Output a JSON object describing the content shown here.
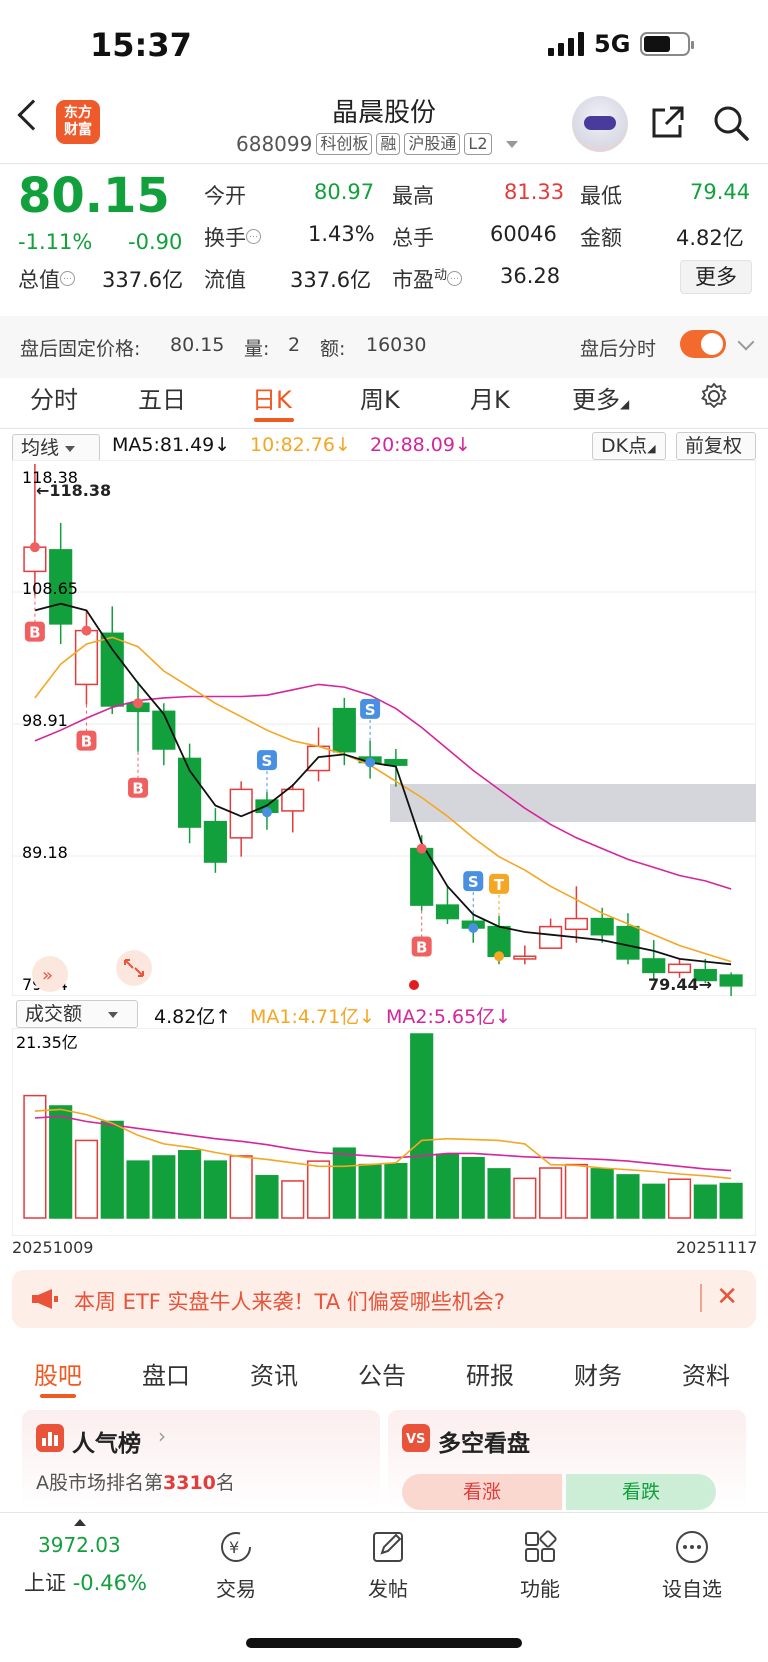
{
  "status": {
    "time": "15:37",
    "network": "5G"
  },
  "header": {
    "logo_text": "东方财富",
    "stock_name": "晶晨股份",
    "stock_code": "688099",
    "tags": [
      "科创板",
      "融",
      "沪股通",
      "L2"
    ]
  },
  "quote": {
    "price": "80.15",
    "change_pct": "-1.11%",
    "change": "-0.90",
    "open_label": "今开",
    "open": "80.97",
    "high_label": "最高",
    "high": "81.33",
    "low_label": "最低",
    "low": "79.44",
    "turnover_label": "换手",
    "turnover": "1.43%",
    "volume_label": "总手",
    "volume": "60046",
    "amount_label": "金额",
    "amount": "4.82亿",
    "mktcap_label": "总值",
    "mktcap": "337.6亿",
    "float_label": "流值",
    "float_cap": "337.6亿",
    "pe_label": "市盈",
    "pe_sup": "动",
    "pe": "36.28",
    "more": "更多"
  },
  "after_hours": {
    "label": "盘后固定价格:",
    "price": "80.15",
    "vol_label": "量:",
    "vol": "2",
    "amt_label": "额:",
    "amt": "16030",
    "switch_label": "盘后分时"
  },
  "tabs": [
    "分时",
    "五日",
    "日K",
    "周K",
    "月K",
    "更多"
  ],
  "active_tab": "日K",
  "ma_bar": {
    "selector": "均线",
    "ma5": "MA5:81.49↓",
    "ma10": "10:82.76↓",
    "ma20": "20:88.09↓",
    "dk": "DK点",
    "adjust": "前复权"
  },
  "colors": {
    "up": "#e43b3b",
    "down": "#11a03c",
    "ma5": "#111111",
    "ma10": "#f5a623",
    "ma20": "#d6259b",
    "accent": "#f05a22"
  },
  "chart_data": {
    "type": "candlestick",
    "price_axis_labels": [
      "118.38",
      "108.65",
      "98.91",
      "89.18",
      "79.44"
    ],
    "ylim": [
      79.44,
      118.38
    ],
    "annotations": {
      "max": "←118.38",
      "min": "79.44→"
    },
    "candles": [
      {
        "o": 110.4,
        "c": 112.2,
        "h": 118.38,
        "l": 108.6
      },
      {
        "o": 112.0,
        "c": 106.5,
        "h": 114.0,
        "l": 105.0
      },
      {
        "o": 102.0,
        "c": 106.0,
        "h": 107.5,
        "l": 100.5
      },
      {
        "o": 105.8,
        "c": 100.4,
        "h": 107.8,
        "l": 99.8
      },
      {
        "o": 100.6,
        "c": 100.0,
        "h": 102.2,
        "l": 97.0
      },
      {
        "o": 100.0,
        "c": 97.2,
        "h": 100.6,
        "l": 96.0
      },
      {
        "o": 96.5,
        "c": 91.4,
        "h": 97.6,
        "l": 90.2
      },
      {
        "o": 91.8,
        "c": 88.8,
        "h": 92.8,
        "l": 88.0
      },
      {
        "o": 90.6,
        "c": 94.2,
        "h": 94.8,
        "l": 89.2
      },
      {
        "o": 93.4,
        "c": 92.5,
        "h": 94.0,
        "l": 91.2
      },
      {
        "o": 92.6,
        "c": 94.2,
        "h": 94.6,
        "l": 91.0
      },
      {
        "o": 95.6,
        "c": 97.4,
        "h": 98.8,
        "l": 94.8
      },
      {
        "o": 100.2,
        "c": 97.0,
        "h": 101.0,
        "l": 96.0
      },
      {
        "o": 96.6,
        "c": 96.2,
        "h": 97.8,
        "l": 95.0
      },
      {
        "o": 96.4,
        "c": 96.0,
        "h": 97.2,
        "l": 94.4
      },
      {
        "o": 89.8,
        "c": 85.6,
        "h": 90.8,
        "l": 85.2
      },
      {
        "o": 85.6,
        "c": 84.6,
        "h": 87.0,
        "l": 84.2
      },
      {
        "o": 84.4,
        "c": 83.9,
        "h": 85.0,
        "l": 82.8
      },
      {
        "o": 84.0,
        "c": 81.8,
        "h": 84.8,
        "l": 81.2
      },
      {
        "o": 81.6,
        "c": 81.8,
        "h": 82.6,
        "l": 81.2
      },
      {
        "o": 82.4,
        "c": 84.0,
        "h": 84.6,
        "l": 82.4
      },
      {
        "o": 83.8,
        "c": 84.6,
        "h": 87.0,
        "l": 82.8
      },
      {
        "o": 84.6,
        "c": 83.4,
        "h": 85.4,
        "l": 82.8
      },
      {
        "o": 84.0,
        "c": 81.6,
        "h": 85.0,
        "l": 81.2
      },
      {
        "o": 81.6,
        "c": 80.6,
        "h": 83.0,
        "l": 80.0
      },
      {
        "o": 80.6,
        "c": 81.2,
        "h": 81.6,
        "l": 80.2
      },
      {
        "o": 80.8,
        "c": 80.0,
        "h": 81.6,
        "l": 79.8
      },
      {
        "o": 80.4,
        "c": 79.6,
        "h": 80.6,
        "l": 78.8
      }
    ],
    "ma5": [
      107.5,
      108.0,
      107.5,
      104.6,
      102.1,
      99.8,
      95.6,
      93.0,
      92.2,
      93.0,
      94.5,
      96.6,
      96.8,
      96.2,
      95.9,
      90.2,
      87.0,
      84.9,
      84.0,
      83.6,
      83.4,
      83.2,
      83.0,
      82.6,
      82.2,
      81.6,
      81.4,
      81.2
    ],
    "ma10": [
      101.0,
      103.5,
      105.0,
      105.5,
      104.8,
      103.0,
      101.8,
      100.6,
      99.6,
      98.6,
      97.8,
      97.4,
      96.8,
      96.0,
      94.8,
      93.6,
      92.2,
      90.6,
      89.2,
      88.2,
      87.0,
      86.0,
      85.0,
      84.2,
      83.4,
      82.6,
      82.0,
      81.4
    ],
    "ma20": [
      97.8,
      98.6,
      99.5,
      100.3,
      100.8,
      101.0,
      101.1,
      101.1,
      101.1,
      101.2,
      101.6,
      102.0,
      101.8,
      101.2,
      100.2,
      98.8,
      97.2,
      95.6,
      94.2,
      92.8,
      91.6,
      90.6,
      89.8,
      89.0,
      88.4,
      87.8,
      87.4,
      86.8
    ],
    "signals": [
      {
        "i": 0,
        "tag": "B"
      },
      {
        "i": 2,
        "tag": "B"
      },
      {
        "i": 4,
        "tag": "B"
      },
      {
        "i": 9,
        "tag": "S"
      },
      {
        "i": 13,
        "tag": "S"
      },
      {
        "i": 15,
        "tag": "B"
      },
      {
        "i": 17,
        "tag": "S"
      },
      {
        "i": 18,
        "tag": "T"
      }
    ],
    "volume": {
      "selector": "成交额",
      "value": "4.82亿↑",
      "ma1": "MA1:4.71亿↓",
      "ma2": "MA2:5.65亿↓",
      "max_label": "21.35亿",
      "start_date": "20251009",
      "end_date": "20251117",
      "values": [
        14.2,
        13.0,
        9.0,
        11.2,
        6.6,
        7.2,
        7.8,
        6.6,
        7.2,
        4.9,
        4.3,
        6.6,
        8.1,
        6.2,
        6.3,
        21.35,
        7.4,
        7.0,
        5.7,
        4.6,
        5.8,
        6.2,
        5.7,
        5.0,
        3.9,
        4.5,
        3.8,
        4.0
      ],
      "ma1_line": [
        12.4,
        12.6,
        12.0,
        11.0,
        9.6,
        8.6,
        8.2,
        7.6,
        7.1,
        6.8,
        6.4,
        6.0,
        6.0,
        6.2,
        6.4,
        9.0,
        9.2,
        9.1,
        9.0,
        8.6,
        6.2,
        6.1,
        5.8,
        5.6,
        5.4,
        5.1,
        4.9,
        4.6
      ],
      "ma2_line": [
        11.6,
        11.8,
        11.2,
        10.8,
        10.4,
        10.0,
        9.6,
        9.2,
        8.9,
        8.5,
        8.0,
        7.6,
        7.4,
        7.2,
        7.0,
        7.2,
        7.5,
        7.5,
        7.3,
        7.1,
        7.0,
        6.9,
        6.8,
        6.6,
        6.3,
        6.0,
        5.7,
        5.5
      ]
    }
  },
  "banner": {
    "text": "本周 ETF 实盘牛人来袭！TA 们偏爱哪些机会?"
  },
  "sections": [
    "股吧",
    "盘口",
    "资讯",
    "公告",
    "研报",
    "财务",
    "资料"
  ],
  "cards": {
    "left_title": "人气榜",
    "left_sub_prefix": "A股市场排名第",
    "left_rank": "3310",
    "left_sub_suffix": "名",
    "right_title": "多空看盘",
    "bull": "看涨",
    "bear": "看跌"
  },
  "bottom": {
    "index_value": "3972.03",
    "index_name": "上证",
    "index_change": "-0.46%",
    "items": [
      "交易",
      "发帖",
      "功能",
      "设自选"
    ]
  }
}
